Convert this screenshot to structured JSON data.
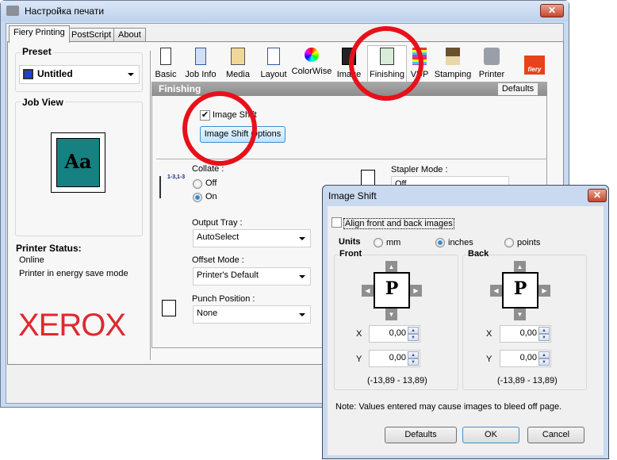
{
  "main_window": {
    "title": "Настройка печати",
    "close": "✕",
    "tabs": [
      "Fiery Printing",
      "PostScript",
      "About"
    ],
    "preset": {
      "label": "Preset",
      "value": "Untitled"
    },
    "job_view": {
      "label": "Job View",
      "preview": "Aa"
    },
    "printer_status": {
      "label": "Printer Status:",
      "lines": [
        "Online",
        "Printer in energy save mode"
      ]
    },
    "logo": "XEROX",
    "toolbar": [
      "Basic",
      "Job Info",
      "Media",
      "Layout",
      "ColorWise",
      "Image",
      "Finishing",
      "VDP",
      "Stamping",
      "Printer"
    ],
    "fiery_logo": "fiery",
    "section": {
      "title": "Finishing",
      "defaults": "Defaults"
    },
    "image_shift": {
      "checkbox": "Image Shift",
      "checked": true,
      "button": "Image Shift Options"
    },
    "collate": {
      "label": "Collate :",
      "icon_text": "1-3,1-3",
      "options": [
        "Off",
        "On"
      ],
      "selected": "On"
    },
    "output_tray": {
      "label": "Output Tray :",
      "value": "AutoSelect"
    },
    "offset_mode": {
      "label": "Offset Mode :",
      "value": "Printer's Default"
    },
    "punch_position": {
      "label": "Punch Position :",
      "value": "None"
    },
    "stapler_mode": {
      "label": "Stapler Mode :",
      "value": "Off"
    }
  },
  "dialog": {
    "title": "Image Shift",
    "close": "✕",
    "align": {
      "label": "Align front and back images",
      "checked": false
    },
    "units": {
      "label": "Units",
      "options": [
        "mm",
        "inches",
        "points"
      ],
      "selected": "inches"
    },
    "front": {
      "label": "Front",
      "glyph": "P",
      "x_label": "X",
      "y_label": "Y",
      "x": "0,00",
      "y": "0,00",
      "range": "(-13,89 - 13,89)"
    },
    "back": {
      "label": "Back",
      "glyph": "P",
      "x_label": "X",
      "y_label": "Y",
      "x": "0,00",
      "y": "0,00",
      "range": "(-13,89 - 13,89)"
    },
    "note": "Note:  Values entered may cause images to bleed off page.",
    "buttons": {
      "defaults": "Defaults",
      "ok": "OK",
      "cancel": "Cancel"
    }
  },
  "colors": {
    "highlight": "#e8101a",
    "xerox": "#e0282e",
    "fiery": "#e8421c"
  }
}
